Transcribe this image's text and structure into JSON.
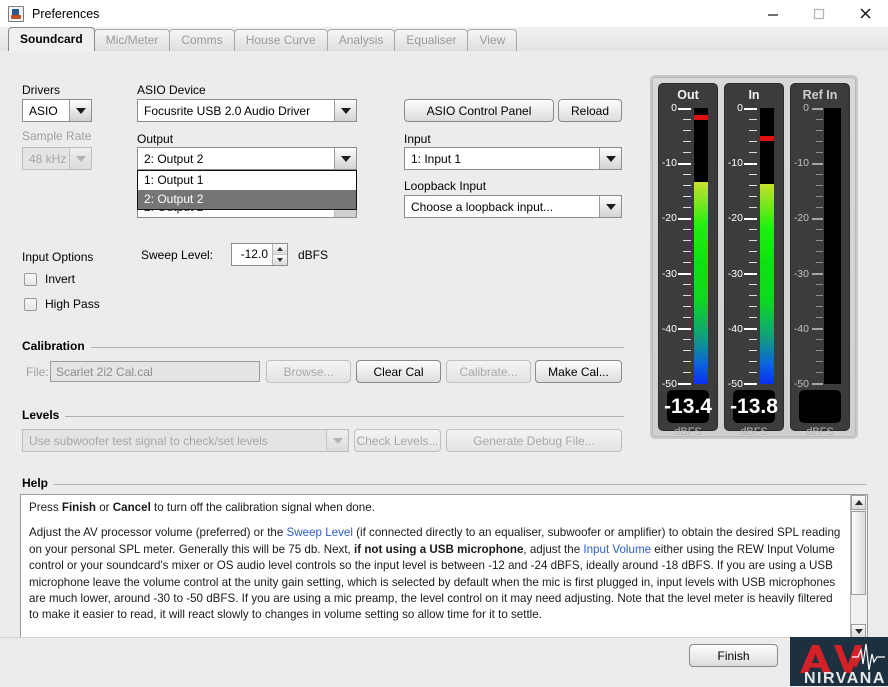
{
  "window": {
    "title": "Preferences",
    "icon": "java-coffee-cup-icon",
    "minimize": "minimize-button",
    "maximize": "maximize-button",
    "close": "close-button"
  },
  "tabs": [
    {
      "label": "Soundcard",
      "active": true
    },
    {
      "label": "Mic/Meter",
      "active": false
    },
    {
      "label": "Comms",
      "active": false
    },
    {
      "label": "House Curve",
      "active": false
    },
    {
      "label": "Analysis",
      "active": false
    },
    {
      "label": "Equaliser",
      "active": false
    },
    {
      "label": "View",
      "active": false
    }
  ],
  "soundcard": {
    "drivers_label": "Drivers",
    "drivers_value": "ASIO",
    "sample_rate_label": "Sample Rate",
    "sample_rate_value": "48 kHz",
    "asio_device_label": "ASIO Device",
    "asio_device_value": "Focusrite USB 2.0 Audio Driver",
    "output_label": "Output",
    "output_value": "2: Output 2",
    "output_options": [
      "1: Output 1",
      "2: Output 2"
    ],
    "output_selected_index": 1,
    "output_obscured_row": "2: Output 2",
    "asio_control_panel": "ASIO Control Panel",
    "reload": "Reload",
    "input_label": "Input",
    "input_value": "1: Input 1",
    "loopback_label": "Loopback Input",
    "loopback_value": "Choose a loopback input...",
    "input_options_label": "Input Options",
    "invert_label": "Invert",
    "invert_checked": false,
    "highpass_label": "High Pass",
    "highpass_checked": false,
    "sweep_level_label": "Sweep Level:",
    "sweep_level_value": "-12.0",
    "sweep_level_units": "dBFS"
  },
  "calibration": {
    "group_title": "Calibration",
    "file_label": "File:",
    "file_value": "Scarlet 2i2 Cal.cal",
    "browse": "Browse...",
    "clear_cal": "Clear Cal",
    "calibrate": "Calibrate...",
    "make_cal": "Make Cal..."
  },
  "levels": {
    "group_title": "Levels",
    "test_signal_value": "Use subwoofer test signal to check/set levels",
    "check_levels": "Check Levels...",
    "generate_debug": "Generate Debug File..."
  },
  "help": {
    "group_title": "Help",
    "para1_pre": "Press ",
    "para1_b1": "Finish",
    "para1_mid": " or ",
    "para1_b2": "Cancel",
    "para1_post": " to turn off the calibration signal when done.",
    "para2_a": "Adjust the AV processor volume (preferred) or the ",
    "para2_link1": "Sweep Level",
    "para2_b": " (if connected directly to an equaliser, subwoofer or amplifier) to obtain the desired SPL reading on your personal SPL meter. Generally this will be 75 db. Next, ",
    "para2_bold1": "if not using a USB microphone",
    "para2_c": ", adjust the ",
    "para2_link2": "Input Volume",
    "para2_d": " either using the REW Input Volume control or your soundcard's mixer or OS audio level controls so the input level is between -12 and -24 dBFS, ideally around -18 dBFS. If you are using a USB microphone leave the volume control at the unity gain setting, which is selected by default when the mic is first plugged in, input levels with USB microphones are much lower, around -30 to -50 dBFS. If you are using a mic preamp, the level control on it may need adjusting. Note that the level meter is heavily filtered to make it easier to read, it will react slowly to changes in volume setting so allow time for it to settle."
  },
  "meters": {
    "units": "dBFS",
    "scale_labels": [
      "0",
      "-10",
      "-20",
      "-30",
      "-40",
      "-50"
    ],
    "channels": [
      {
        "name": "Out",
        "value": "-13.4",
        "level_db": -13.4,
        "peak_db": -1.2,
        "active": true
      },
      {
        "name": "In",
        "value": "-13.8",
        "level_db": -13.8,
        "peak_db": -5.0,
        "active": true
      },
      {
        "name": "Ref In",
        "value": "",
        "level_db": null,
        "peak_db": null,
        "active": false
      }
    ]
  },
  "footer": {
    "finish": "Finish",
    "logo_line1": "AV",
    "logo_line2": "NIRVANA"
  },
  "colors": {
    "accent_link": "#2d5fc4",
    "peak": "#e01010",
    "meter_bg": "#3c3c3c",
    "panel_bg": "#ececec",
    "logo_bg": "#1d3040",
    "logo_red": "#d42027"
  }
}
